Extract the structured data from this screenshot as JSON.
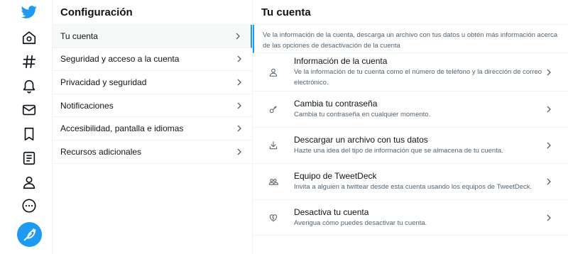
{
  "nav": {
    "icons": [
      "twitter-logo",
      "home-icon",
      "explore-hashtag-icon",
      "notifications-bell-icon",
      "messages-mail-icon",
      "bookmarks-icon",
      "lists-icon",
      "profile-icon",
      "more-icon",
      "compose-tweet-icon"
    ]
  },
  "settings": {
    "title": "Configuración",
    "items": [
      {
        "label": "Tu cuenta"
      },
      {
        "label": "Seguridad y acceso a la cuenta"
      },
      {
        "label": "Privacidad y seguridad"
      },
      {
        "label": "Notificaciones"
      },
      {
        "label": "Accesibilidad, pantalla e idiomas"
      },
      {
        "label": "Recursos adicionales"
      }
    ]
  },
  "account": {
    "title": "Tu cuenta",
    "intro": "Ve la información de la cuenta, descarga un archivo con tus datos u obtén más información acerca de las opciones de desactivación de la cuenta",
    "options": [
      {
        "title": "Información de la cuenta",
        "desc": "Ve la información de tu cuenta como el número de teléfono y la dirección de correo electrónico."
      },
      {
        "title": "Cambia tu contraseña",
        "desc": "Cambia tu contraseña en cualquier momento."
      },
      {
        "title": "Descargar un archivo con tus datos",
        "desc": "Hazte una idea del tipo de información que se almacena de tu cuenta."
      },
      {
        "title": "Equipo de TweetDeck",
        "desc": "Invita a alguien a twittear desde esta cuenta usando los equipos de TweetDeck."
      },
      {
        "title": "Desactiva tu cuenta",
        "desc": "Averigua cómo puedes desactivar tu cuenta."
      }
    ]
  },
  "colors": {
    "accent": "#1d9bf0",
    "text": "#0f1419",
    "secondary": "#536471",
    "divider": "#eff3f4"
  }
}
